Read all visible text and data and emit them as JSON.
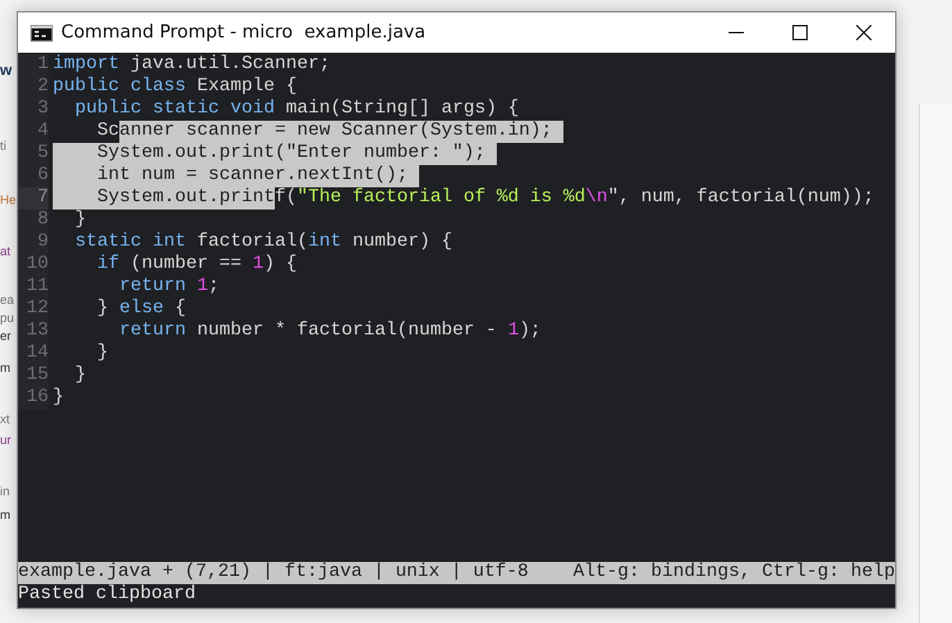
{
  "background_page": {
    "fragments": [
      {
        "text": "w",
        "kind": "heading"
      },
      {
        "text": "ti",
        "kind": "plain"
      },
      {
        "text": "He",
        "kind": "accent"
      },
      {
        "text": "at",
        "kind": "keyword"
      },
      {
        "text": "ea",
        "kind": "plain"
      },
      {
        "text": "pu",
        "kind": "plain"
      },
      {
        "text": "er",
        "kind": "dark"
      },
      {
        "text": "m",
        "kind": "dark"
      },
      {
        "text": "xt",
        "kind": "plain"
      },
      {
        "text": "ur",
        "kind": "keyword"
      },
      {
        "text": "in",
        "kind": "plain"
      },
      {
        "text": "m",
        "kind": "dark"
      }
    ]
  },
  "window": {
    "title": "Command Prompt - micro  example.java"
  },
  "editor": {
    "lines": [
      {
        "number": "1",
        "current": false,
        "selection_eol": false,
        "tokens": [
          {
            "text": "import",
            "kind": "keyword",
            "selected": false
          },
          {
            "text": " java.util.Scanner;",
            "kind": "plain",
            "selected": false
          }
        ]
      },
      {
        "number": "2",
        "current": false,
        "selection_eol": false,
        "tokens": [
          {
            "text": "public",
            "kind": "keyword",
            "selected": false
          },
          {
            "text": " class",
            "kind": "keyword",
            "selected": false
          },
          {
            "text": " Example {",
            "kind": "plain",
            "selected": false
          }
        ]
      },
      {
        "number": "3",
        "current": false,
        "selection_eol": false,
        "tokens": [
          {
            "text": "  public",
            "kind": "keyword",
            "selected": false
          },
          {
            "text": " static",
            "kind": "keyword",
            "selected": false
          },
          {
            "text": " void",
            "kind": "keyword",
            "selected": false
          },
          {
            "text": " main(String[] args) {",
            "kind": "plain",
            "selected": false
          }
        ]
      },
      {
        "number": "4",
        "current": false,
        "selection_eol": true,
        "tokens": [
          {
            "text": "    Sc",
            "kind": "plain",
            "selected": false
          },
          {
            "text": "anner scanner = new Scanner(System.in);",
            "kind": "plain",
            "selected": true
          }
        ]
      },
      {
        "number": "5",
        "current": false,
        "selection_eol": true,
        "tokens": [
          {
            "text": "    System.out.print(\"Enter number: \");",
            "kind": "plain",
            "selected": true
          }
        ]
      },
      {
        "number": "6",
        "current": false,
        "selection_eol": true,
        "tokens": [
          {
            "text": "    int num = scanner.nextInt();",
            "kind": "plain",
            "selected": true
          }
        ]
      },
      {
        "number": "7",
        "current": true,
        "selection_eol": false,
        "tokens": [
          {
            "text": "    System.out.print",
            "kind": "plain",
            "selected": true
          },
          {
            "text": "f(",
            "kind": "plain",
            "selected": false
          },
          {
            "text": "\"The factorial of %d is %d",
            "kind": "string",
            "selected": false
          },
          {
            "text": "\\n",
            "kind": "escape",
            "selected": false
          },
          {
            "text": "\", num, factorial(num));",
            "kind": "plain",
            "selected": false
          }
        ]
      },
      {
        "number": "8",
        "current": false,
        "selection_eol": false,
        "tokens": [
          {
            "text": "  }",
            "kind": "plain",
            "selected": false
          }
        ]
      },
      {
        "number": "9",
        "current": false,
        "selection_eol": false,
        "tokens": [
          {
            "text": "  static",
            "kind": "keyword",
            "selected": false
          },
          {
            "text": " int",
            "kind": "keyword",
            "selected": false
          },
          {
            "text": " factorial(",
            "kind": "plain",
            "selected": false
          },
          {
            "text": "int",
            "kind": "keyword",
            "selected": false
          },
          {
            "text": " number) {",
            "kind": "plain",
            "selected": false
          }
        ]
      },
      {
        "number": "10",
        "current": false,
        "selection_eol": false,
        "tokens": [
          {
            "text": "    if",
            "kind": "keyword",
            "selected": false
          },
          {
            "text": " (number == ",
            "kind": "plain",
            "selected": false
          },
          {
            "text": "1",
            "kind": "number",
            "selected": false
          },
          {
            "text": ") {",
            "kind": "plain",
            "selected": false
          }
        ]
      },
      {
        "number": "11",
        "current": false,
        "selection_eol": false,
        "tokens": [
          {
            "text": "      return",
            "kind": "keyword",
            "selected": false
          },
          {
            "text": " 1",
            "kind": "number",
            "selected": false
          },
          {
            "text": ";",
            "kind": "plain",
            "selected": false
          }
        ]
      },
      {
        "number": "12",
        "current": false,
        "selection_eol": false,
        "tokens": [
          {
            "text": "    } ",
            "kind": "plain",
            "selected": false
          },
          {
            "text": "else",
            "kind": "keyword",
            "selected": false
          },
          {
            "text": " {",
            "kind": "plain",
            "selected": false
          }
        ]
      },
      {
        "number": "13",
        "current": false,
        "selection_eol": false,
        "tokens": [
          {
            "text": "      return",
            "kind": "keyword",
            "selected": false
          },
          {
            "text": " number * factorial(number - ",
            "kind": "plain",
            "selected": false
          },
          {
            "text": "1",
            "kind": "number",
            "selected": false
          },
          {
            "text": ");",
            "kind": "plain",
            "selected": false
          }
        ]
      },
      {
        "number": "14",
        "current": false,
        "selection_eol": false,
        "tokens": [
          {
            "text": "    }",
            "kind": "plain",
            "selected": false
          }
        ]
      },
      {
        "number": "15",
        "current": false,
        "selection_eol": false,
        "tokens": [
          {
            "text": "  }",
            "kind": "plain",
            "selected": false
          }
        ]
      },
      {
        "number": "16",
        "current": false,
        "selection_eol": false,
        "tokens": [
          {
            "text": "}",
            "kind": "plain",
            "selected": false
          }
        ]
      }
    ]
  },
  "status_bar": {
    "left": "example.java + (7,21) | ft:java | unix | utf-8",
    "right": "Alt-g: bindings, Ctrl-g: help"
  },
  "message": "Pasted clipboard"
}
